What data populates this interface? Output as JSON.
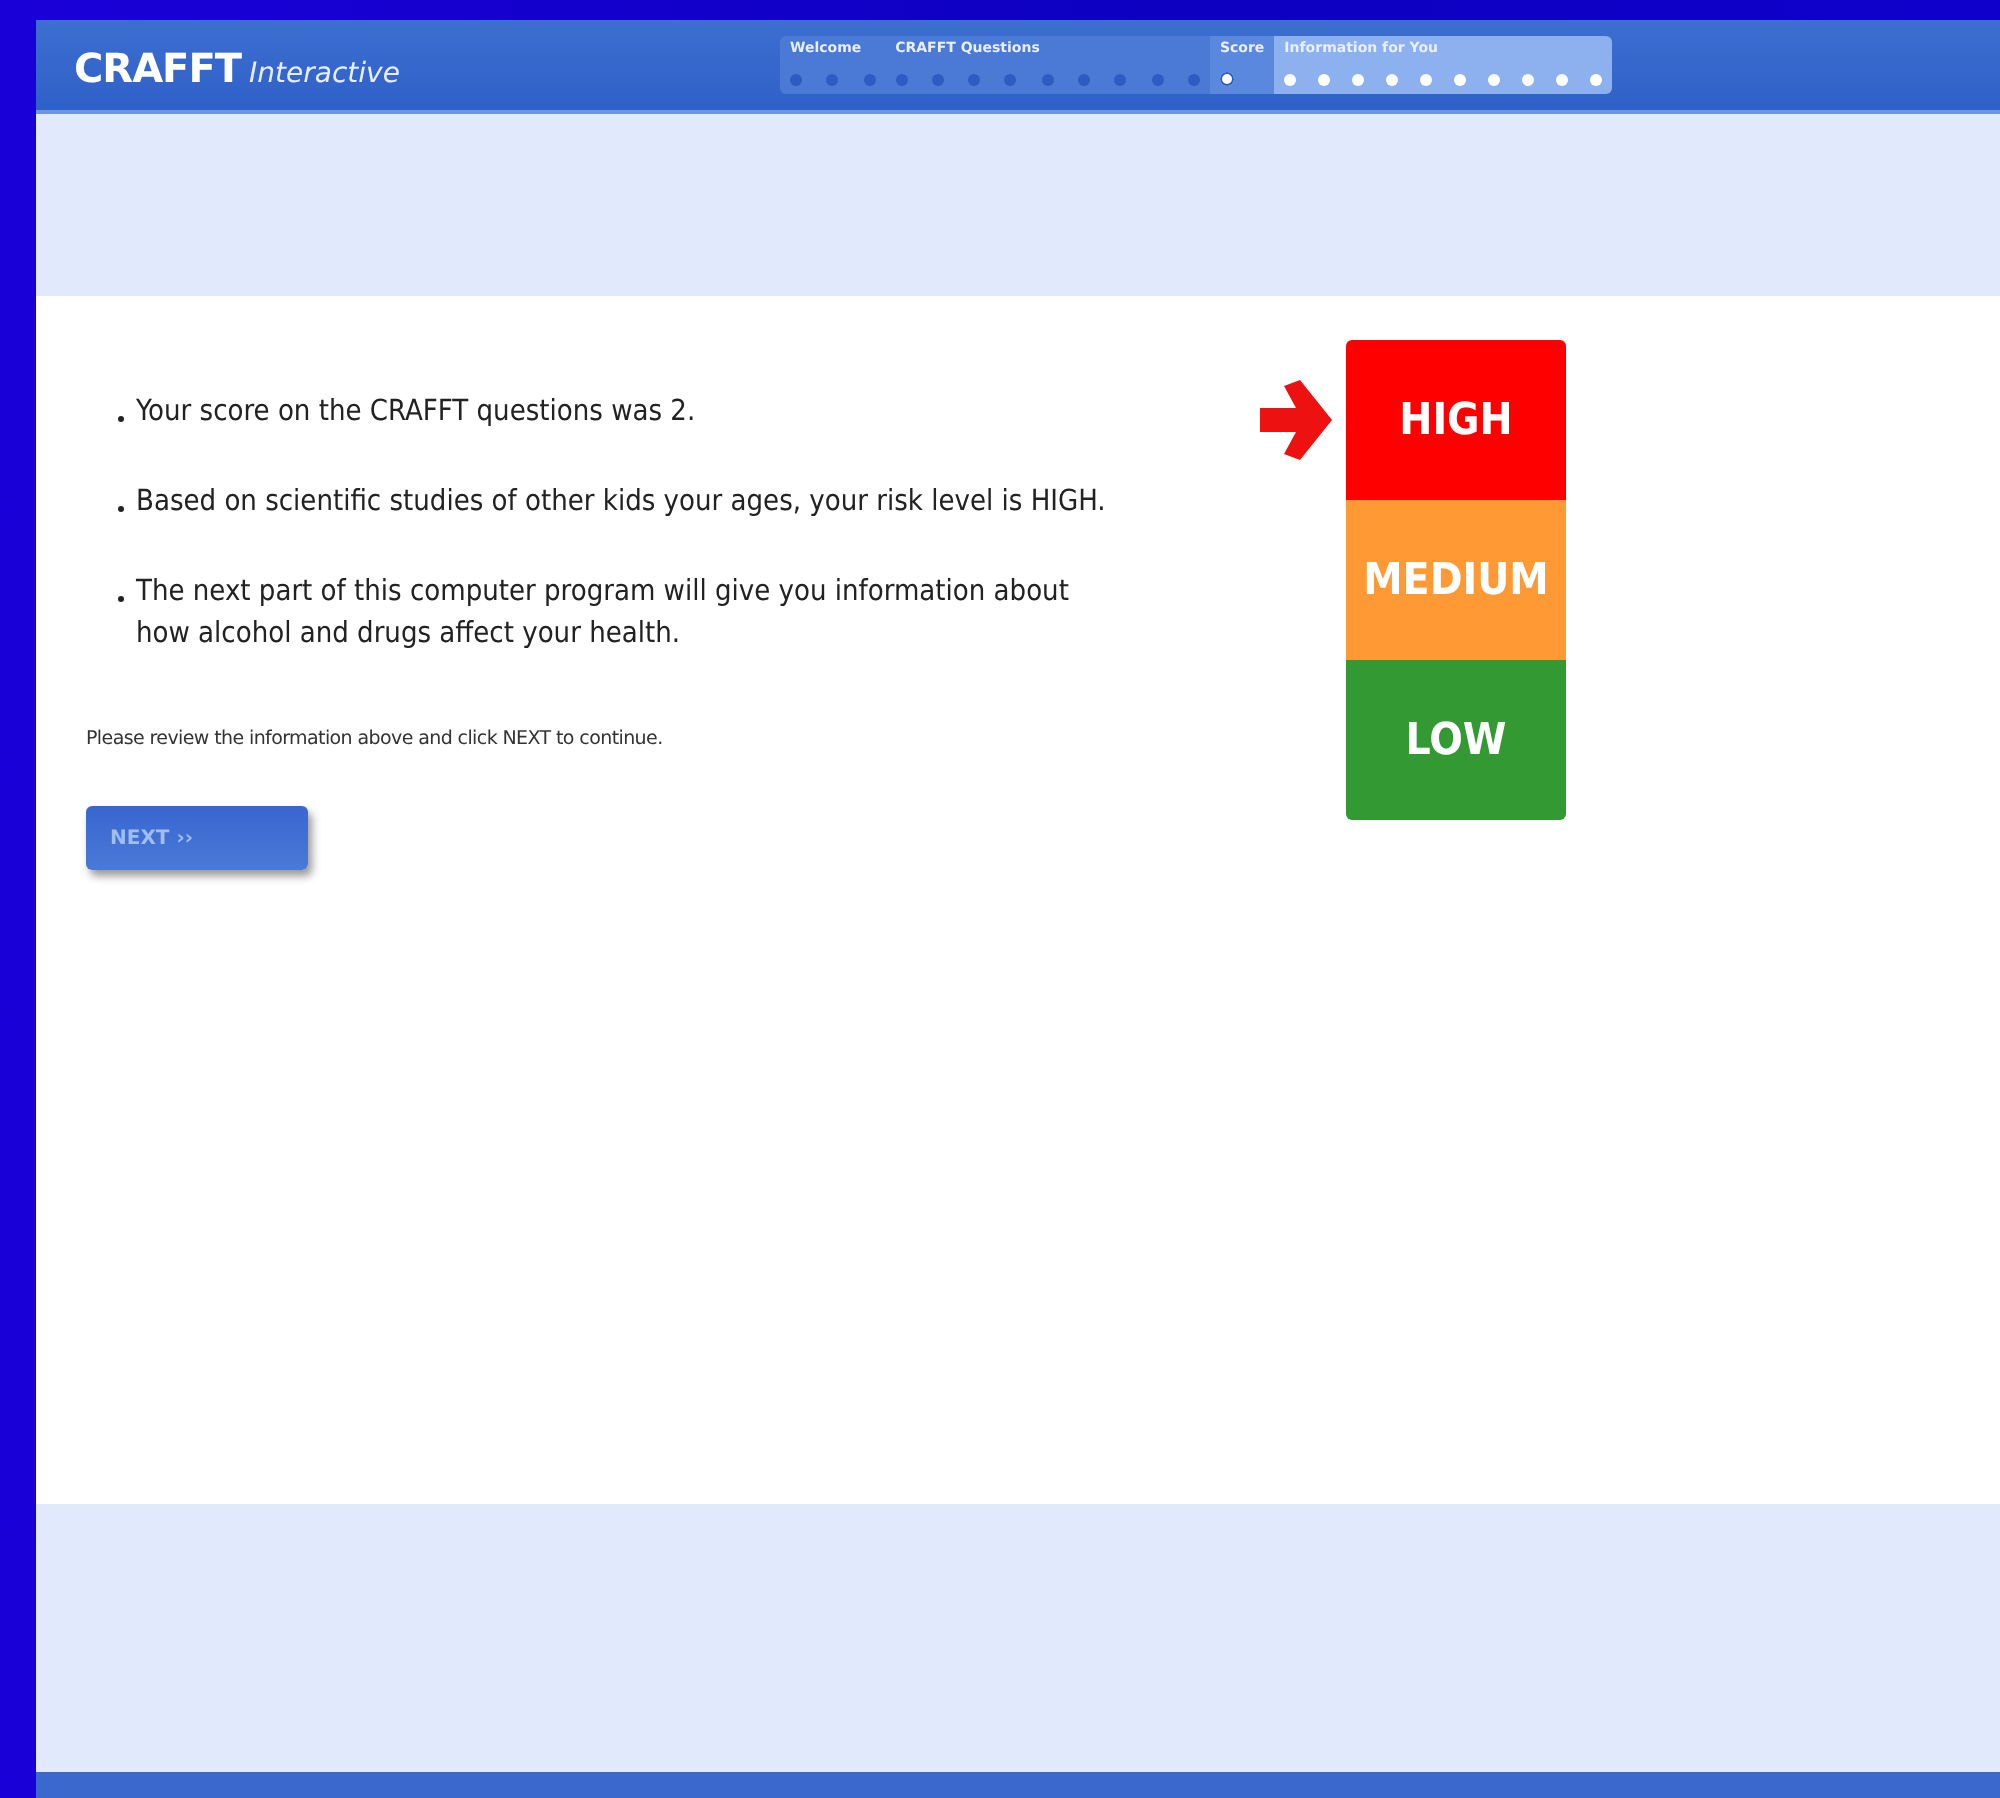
{
  "header": {
    "title": "CRAFFT",
    "subtitle": "Interactive"
  },
  "progress": [
    {
      "label": "Welcome",
      "completed": true,
      "selected": false,
      "steps": [
        {
          "current": false
        },
        {
          "current": false
        },
        {
          "current": false
        }
      ]
    },
    {
      "label": "CRAFFT Questions",
      "completed": true,
      "selected": false,
      "steps": [
        {
          "current": false
        },
        {
          "current": false
        },
        {
          "current": false
        },
        {
          "current": false
        },
        {
          "current": false
        },
        {
          "current": false
        },
        {
          "current": false
        },
        {
          "current": false
        },
        {
          "current": false
        }
      ]
    },
    {
      "label": "Score",
      "completed": false,
      "selected": true,
      "steps": [
        {
          "current": true
        }
      ]
    },
    {
      "label": "Information for You",
      "completed": false,
      "selected": false,
      "steps": [
        {
          "current": false
        },
        {
          "current": false
        },
        {
          "current": false
        },
        {
          "current": false
        },
        {
          "current": false
        },
        {
          "current": false
        },
        {
          "current": false
        },
        {
          "current": false
        },
        {
          "current": false
        },
        {
          "current": false
        }
      ]
    }
  ],
  "bullets": [
    "Your score on the CRAFFT questions was 2.",
    "Based on scientific studies of other kids your ages, your risk level is HIGH.",
    "The next part of this computer program will give you information about how alcohol and drugs affect your health."
  ],
  "risk_levels": [
    {
      "label": "HIGH",
      "color": "#ff0000",
      "selected": true
    },
    {
      "label": "MEDIUM",
      "color": "#ff9933",
      "selected": false
    },
    {
      "label": "LOW",
      "color": "#339933",
      "selected": false
    }
  ],
  "instruction": "Please review the information above and click NEXT to continue.",
  "next_button": "NEXT ››"
}
